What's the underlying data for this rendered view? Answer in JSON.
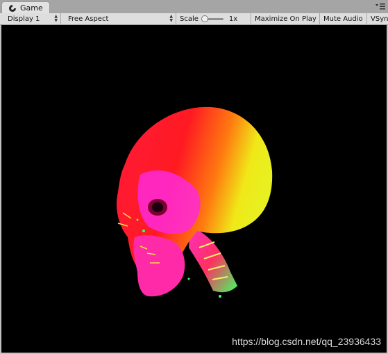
{
  "tab": {
    "title": "Game",
    "icon": "game-controller-icon"
  },
  "toolbar": {
    "display": "Display 1",
    "aspect": "Free Aspect",
    "scale_label": "Scale",
    "scale_value": "1x",
    "scale_level": 0.0,
    "maximize": "Maximize On Play",
    "mute": "Mute Audio",
    "vsync": "VSync"
  },
  "viewport": {
    "background": "#000000",
    "watermark": "https://blog.csdn.net/qq_23936433"
  }
}
